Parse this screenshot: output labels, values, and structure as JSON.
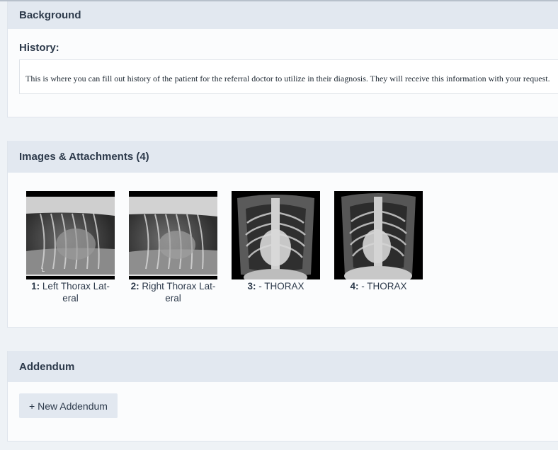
{
  "background": {
    "title": "Background",
    "history_label": "History:",
    "history_text": "This is where you can fill out history of the patient for the referral doctor to utilize in their diagnosis. They will receive this information with your request."
  },
  "images": {
    "title": "Images & Attachments (4)",
    "items": [
      {
        "num": "1:",
        "label": "Left Thorax Lat-eral",
        "line1": "Left Thorax Lat-",
        "line2": "eral",
        "kind": "lateral"
      },
      {
        "num": "2:",
        "label": "Right Thorax Lat-eral",
        "line1": "Right Thorax Lat-",
        "line2": "eral",
        "kind": "lateral"
      },
      {
        "num": "3:",
        "label": "- THORAX",
        "line1": "- THORAX",
        "line2": "",
        "kind": "vd"
      },
      {
        "num": "4:",
        "label": "- THORAX",
        "line1": "- THORAX",
        "line2": "",
        "kind": "vd"
      }
    ]
  },
  "addendum": {
    "title": "Addendum",
    "new_button": "+ New Addendum"
  },
  "colors": {
    "page_bg": "#eef2f6",
    "header_bg": "#e2e8f0",
    "panel_bg": "#fbfcfd",
    "text": "#2d3a4b"
  }
}
